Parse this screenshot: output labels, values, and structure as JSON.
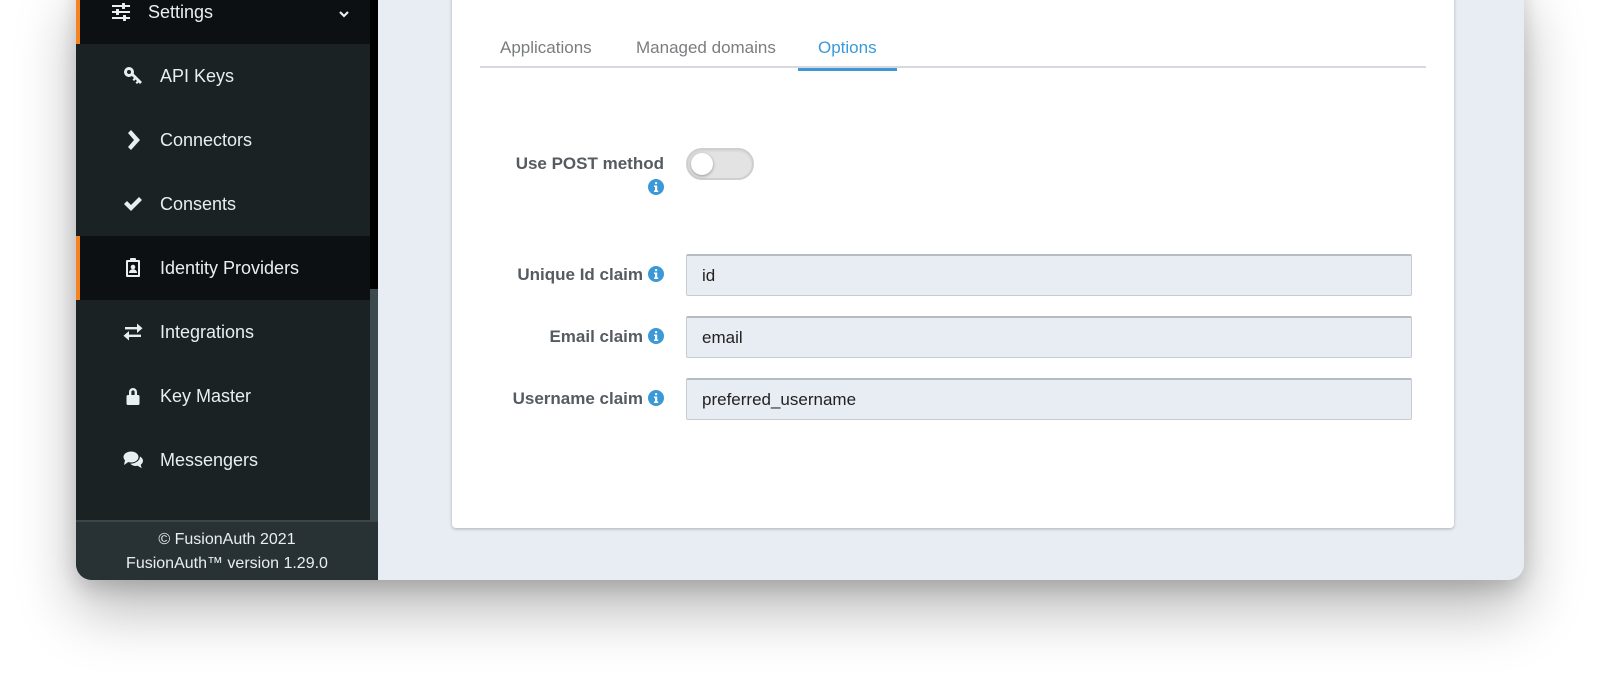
{
  "sidebar": {
    "parent": {
      "label": "Settings",
      "icon": "sliders-icon"
    },
    "items": [
      {
        "label": "API Keys",
        "icon": "key-icon",
        "active": false
      },
      {
        "label": "Connectors",
        "icon": "chevron-right-icon",
        "active": false
      },
      {
        "label": "Consents",
        "icon": "check-icon",
        "active": false
      },
      {
        "label": "Identity Providers",
        "icon": "id-badge-icon",
        "active": true
      },
      {
        "label": "Integrations",
        "icon": "exchange-icon",
        "active": false
      },
      {
        "label": "Key Master",
        "icon": "lock-icon",
        "active": false
      },
      {
        "label": "Messengers",
        "icon": "comments-icon",
        "active": false
      }
    ],
    "footer": {
      "copyright": "© FusionAuth 2021",
      "version": "FusionAuth™ version 1.29.0"
    }
  },
  "tabs": [
    {
      "label": "Applications",
      "active": false
    },
    {
      "label": "Managed domains",
      "active": false
    },
    {
      "label": "Options",
      "active": true
    }
  ],
  "form": {
    "use_post_method": {
      "label": "Use POST method",
      "enabled": false
    },
    "unique_id_claim": {
      "label": "Unique Id claim",
      "value": "id"
    },
    "email_claim": {
      "label": "Email claim",
      "value": "email"
    },
    "username_claim": {
      "label": "Username claim",
      "value": "preferred_username"
    }
  },
  "colors": {
    "accent": "#3b99d8",
    "sidebar_active_marker": "#f58320",
    "sidebar_bg": "#1b2224"
  }
}
